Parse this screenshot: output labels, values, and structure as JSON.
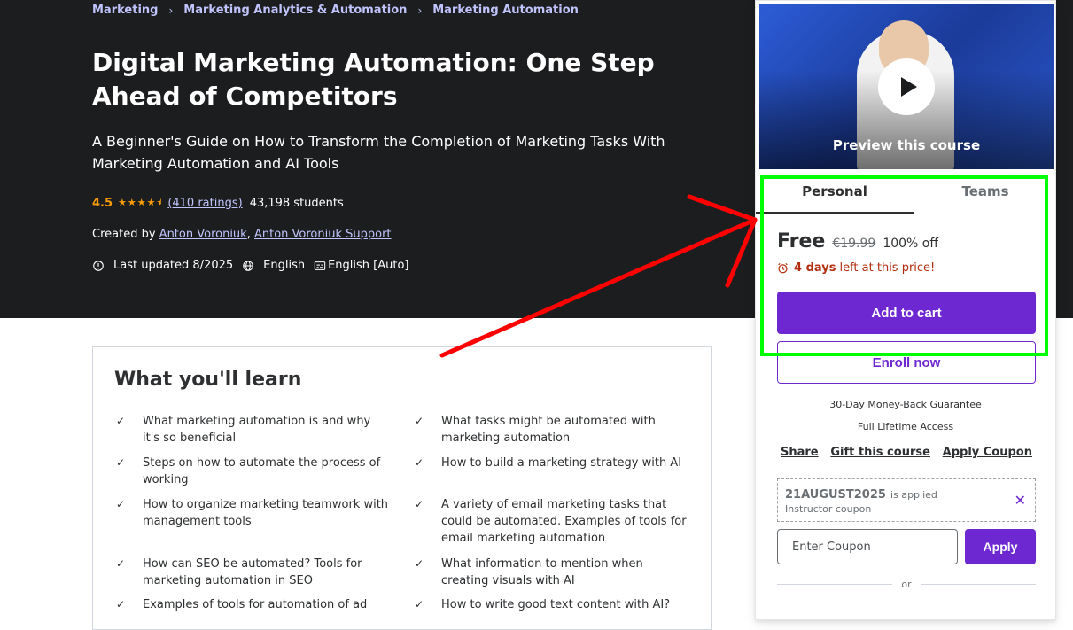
{
  "breadcrumb": [
    "Marketing",
    "Marketing Analytics & Automation",
    "Marketing Automation"
  ],
  "course": {
    "title": "Digital Marketing Automation: One Step Ahead of Competitors",
    "subtitle": "A Beginner's Guide on How to Transform the Completion of Marketing Tasks With Marketing Automation and AI Tools",
    "rating": "4.5",
    "rating_stars": 4.5,
    "ratings_count": "(410 ratings)",
    "students": "43,198 students",
    "created_by_label": "Created by",
    "authors": [
      "Anton Voroniuk",
      "Anton Voroniuk Support"
    ],
    "author_separator": ",",
    "last_updated": "Last updated 8/2025",
    "language": "English",
    "captions": "English [Auto]"
  },
  "learn": {
    "title": "What you'll learn",
    "items": [
      "What marketing automation is and why it's so beneficial",
      "What tasks might be automated with marketing automation",
      "Steps on how to automate the process of working",
      "How to build a marketing strategy with AI",
      "How to organize marketing teamwork with management tools",
      "A variety of email marketing tasks that could be automated. Examples of tools for email marketing automation",
      "How can SEO be automated? Tools for marketing automation in SEO",
      "What information to mention when creating visuals with AI",
      "Examples of tools for automation of ad",
      "How to write good text content with AI?"
    ]
  },
  "sidebar": {
    "preview_label": "Preview this course",
    "tabs": [
      "Personal",
      "Teams"
    ],
    "active_tab": "Personal",
    "price": "Free",
    "original_price": "€19.99",
    "discount": "100% off",
    "countdown_bold": "4 days",
    "countdown_rest": "left at this price!",
    "add_to_cart": "Add to cart",
    "enroll_now": "Enroll now",
    "guarantee": "30-Day Money-Back Guarantee",
    "lifetime": "Full Lifetime Access",
    "links": [
      "Share",
      "Gift this course",
      "Apply Coupon"
    ],
    "coupon_code": "21AUGUST2025",
    "coupon_applied": "is applied",
    "coupon_type": "Instructor coupon",
    "coupon_placeholder": "Enter Coupon",
    "apply": "Apply",
    "or": "or"
  },
  "colors": {
    "hero_bg": "#1c1d1f",
    "accent_purple": "#6d28d2",
    "link_lavender": "#c0c4fc",
    "star_orange": "#f69c08",
    "countdown_red": "#b32d0f",
    "annotation_arrow": "#ff0000",
    "annotation_box": "#00ff00"
  },
  "icons": {
    "breadcrumb_separator": "chevron-right-icon",
    "updated": "alert-badge-icon",
    "language": "globe-icon",
    "captions": "closed-captions-icon",
    "learn_check": "check-icon",
    "countdown": "alarm-clock-icon",
    "coupon_remove": "close-icon",
    "play": "play-icon"
  }
}
